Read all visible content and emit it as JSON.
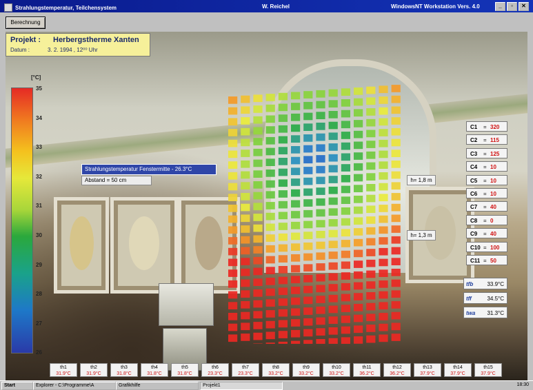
{
  "window": {
    "title": "Strahlungstemperatur, Teilchensystem",
    "author": "W. Reichel",
    "system": "WindowsNT Workstation Vers. 4.0",
    "min_glyph": "_",
    "max_glyph": "▫",
    "close_glyph": "✕"
  },
  "toolbar": {
    "calc_label": "Berechnung"
  },
  "project": {
    "project_label": "Projekt :",
    "project_value": "Herbergstherme Xanten",
    "date_label": "Datum    :",
    "date_value": "3. 2. 1994 , 12⁰⁰ Uhr"
  },
  "scale": {
    "unit": "[°C]",
    "ticks": [
      "35",
      "34",
      "33",
      "32",
      "31",
      "30",
      "29",
      "28",
      "27",
      "26"
    ]
  },
  "overlay": {
    "info": "Strahlungstemperatur Fenstermitte - 26.3°C",
    "distance": "Abstand =  50 cm",
    "h1": "h= 1,8 m",
    "h2": "h= 1,3 m"
  },
  "constants": [
    {
      "name": "C1",
      "eq": "=",
      "value": "320"
    },
    {
      "name": "C2",
      "eq": "=",
      "value": "115"
    },
    {
      "name": "C3",
      "eq": "=",
      "value": "125"
    },
    {
      "name": "C4",
      "eq": "=",
      "value": "10"
    },
    {
      "name": "C5",
      "eq": "=",
      "value": "10"
    },
    {
      "name": "C6",
      "eq": "=",
      "value": "10"
    },
    {
      "name": "C7",
      "eq": "=",
      "value": "40"
    },
    {
      "name": "C8",
      "eq": "=",
      "value": "0"
    },
    {
      "name": "C9",
      "eq": "=",
      "value": "40"
    },
    {
      "name": "C10",
      "eq": "=",
      "value": "100"
    },
    {
      "name": "C11",
      "eq": "=",
      "value": "50"
    }
  ],
  "temps": [
    {
      "name": "tfb",
      "value": "33.9°C"
    },
    {
      "name": "tff",
      "value": "34.5°C"
    },
    {
      "name": "twa",
      "value": "31.3°C"
    }
  ],
  "thermo": [
    {
      "name": "th1",
      "value": "31.9°C"
    },
    {
      "name": "th2",
      "value": "31.9°C"
    },
    {
      "name": "th3",
      "value": "31.8°C"
    },
    {
      "name": "th4",
      "value": "31.8°C"
    },
    {
      "name": "th5",
      "value": "31.8°C"
    },
    {
      "name": "th6",
      "value": "23.3°C"
    },
    {
      "name": "th7",
      "value": "23.3°C"
    },
    {
      "name": "th8",
      "value": "33.2°C"
    },
    {
      "name": "th9",
      "value": "33.2°C"
    },
    {
      "name": "th10",
      "value": "33.2°C"
    },
    {
      "name": "th11",
      "value": "36.2°C"
    },
    {
      "name": "th12",
      "value": "36.2°C"
    },
    {
      "name": "th13",
      "value": "37.9°C"
    },
    {
      "name": "th14",
      "value": "37.9°C"
    },
    {
      "name": "th15",
      "value": "37.9°C"
    }
  ],
  "taskbar": {
    "start": "Start",
    "item1": "Explorer - C:\\Programme\\A",
    "item2": "Grafikhilfe",
    "item3": "Projekt1",
    "clock": "18:30"
  },
  "colors": {
    "titlebar": "#0a1a8c",
    "value_red": "#d01010",
    "info_blue": "#2f46a8"
  }
}
